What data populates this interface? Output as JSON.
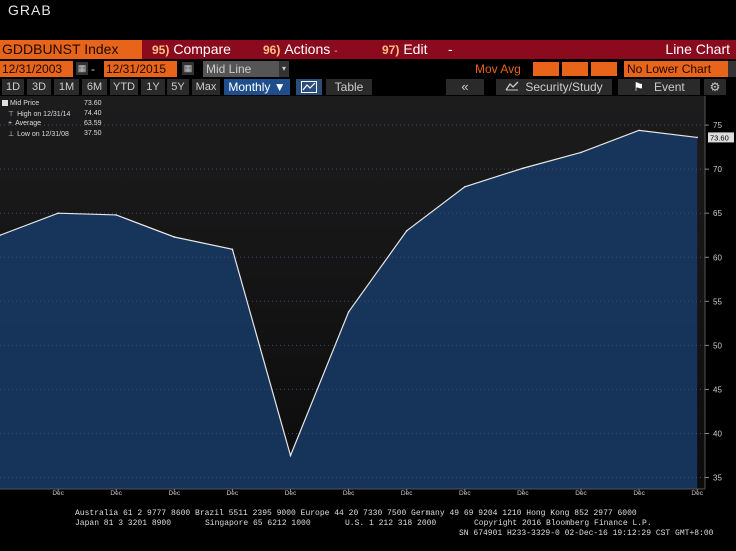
{
  "window": {
    "title": "GRAB"
  },
  "command_bar": {
    "ticker": "GDDBUNST Index",
    "compare": {
      "num": "95)",
      "label": "Compare"
    },
    "actions": {
      "num": "96)",
      "label": "Actions",
      "arrow": "-"
    },
    "edit": {
      "num": "97)",
      "label": "Edit",
      "arrow": "-"
    },
    "chart_type": "Line Chart"
  },
  "date_bar": {
    "start_date": "12/31/2003",
    "end_date": "12/31/2015",
    "date_sep": "-",
    "price_field": "Mid Line",
    "mov_avg_label": "Mov Avg",
    "lower_chart": "No Lower Chart"
  },
  "range_bar": {
    "ranges": [
      "1D",
      "3D",
      "1M",
      "6M",
      "YTD",
      "1Y",
      "5Y",
      "Max"
    ],
    "frequency": "Monthly",
    "table_label": "Table",
    "back_label": "«",
    "security_study": "Security/Study",
    "event": "Event",
    "icons": [
      "line-chart-icon",
      "study-icon",
      "flag-icon",
      "gear-icon"
    ]
  },
  "legend": {
    "rows": [
      {
        "label": "Mid Price",
        "value": "73.60"
      },
      {
        "label": "High on 12/31/14",
        "value": "74.40"
      },
      {
        "label": "Average",
        "value": "63.59"
      },
      {
        "label": "Low on 12/31/08",
        "value": "37.50"
      }
    ]
  },
  "footer": {
    "line1": "Australia 61 2 9777 8600 Brazil 5511 2395 9000 Europe 44 20 7330 7500 Germany 49 69 9204 1210 Hong Kong 852 2977 6000",
    "line2a": "Japan 81 3 3201 8900",
    "line2b": "Singapore 65 6212 1000",
    "line2c": "U.S. 1 212 318 2000",
    "line2d": "Copyright 2016 Bloomberg Finance L.P.",
    "line3": "SN 674901 H233-3329-0 02-Dec-16 19:12:29 CST  GMT+8:00"
  },
  "colors": {
    "area_fill": "#17375e",
    "line": "#e6e6e6",
    "ticker_orange": "#e8641a",
    "command_red": "#8b0a1e"
  },
  "chart_data": {
    "type": "area",
    "x": [
      "Dec 2003",
      "Dec 2004",
      "Dec 2005",
      "Dec 2006",
      "Dec 2007",
      "Dec 2008",
      "Dec 2009",
      "Dec 2010",
      "Dec 2011",
      "Dec 2012",
      "Dec 2013",
      "Dec 2014",
      "Dec 2015"
    ],
    "series": [
      {
        "name": "Mid Price",
        "values": [
          62.5,
          65.0,
          64.8,
          62.3,
          60.9,
          37.5,
          53.8,
          63.0,
          68.0,
          70.1,
          71.9,
          74.4,
          73.6
        ]
      }
    ],
    "y_ticks": [
      35,
      40,
      45,
      50,
      55,
      60,
      65,
      70,
      75
    ],
    "ylim": [
      33.7,
      78.3
    ],
    "x_month_labels": [
      "Dec",
      "Dec",
      "Dec",
      "Dec",
      "Dec",
      "Dec",
      "Dec",
      "Dec",
      "Dec",
      "Dec",
      "Dec",
      "Dec"
    ],
    "x_year_labels": [
      "2004",
      "2005",
      "2006",
      "2007",
      "2008",
      "2009",
      "2010",
      "2011",
      "2012",
      "2013",
      "2014",
      "2015"
    ],
    "last_value_label": "73.60",
    "grid": true
  }
}
